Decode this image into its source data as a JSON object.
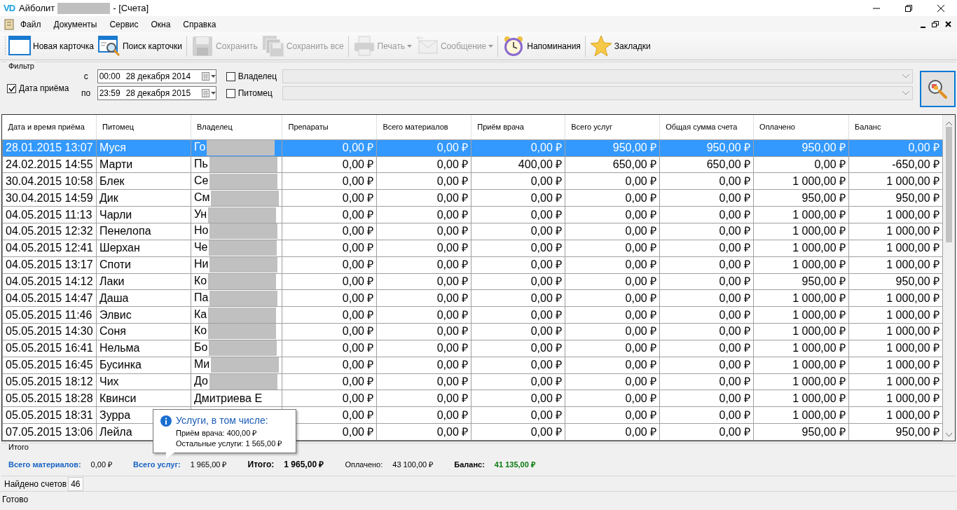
{
  "window": {
    "logo": "VD",
    "title": "Айболит",
    "title_suffix": "- [Счета]",
    "title_redacted": true
  },
  "menu": [
    "Файл",
    "Документы",
    "Сервис",
    "Окна",
    "Справка"
  ],
  "toolbar": [
    {
      "label": "Новая карточка",
      "kind": "new-card",
      "disabled": false,
      "dropdown": false
    },
    {
      "label": "Поиск карточки",
      "kind": "find-card",
      "disabled": false,
      "dropdown": false
    },
    {
      "kind": "separator"
    },
    {
      "label": "Сохранить",
      "kind": "save",
      "disabled": true,
      "dropdown": false
    },
    {
      "label": "Сохранить все",
      "kind": "save-all",
      "disabled": true,
      "dropdown": false
    },
    {
      "kind": "separator"
    },
    {
      "label": "Печать",
      "kind": "print",
      "disabled": true,
      "dropdown": true
    },
    {
      "label": "Сообщение",
      "kind": "message",
      "disabled": true,
      "dropdown": true
    },
    {
      "kind": "separator"
    },
    {
      "label": "Напоминания",
      "kind": "reminder",
      "disabled": false,
      "dropdown": false
    },
    {
      "kind": "separator"
    },
    {
      "label": "Закладки",
      "kind": "bookmark",
      "disabled": false,
      "dropdown": false
    }
  ],
  "filter": {
    "title": "Фильтр",
    "date_check": {
      "label": "Дата приёма",
      "checked": true
    },
    "from": {
      "label": "с",
      "time": "00:00",
      "date": "28 декабря  2014"
    },
    "to": {
      "label": "по",
      "time": "23:59",
      "date": "28 декабря  2015"
    },
    "owner": {
      "label": "Владелец",
      "checked": false
    },
    "pet": {
      "label": "Питомец",
      "checked": false
    }
  },
  "table": {
    "columns": [
      "Дата и время приёма",
      "Питомец",
      "Владелец",
      "Препараты",
      "Всего материалов",
      "Приём врача",
      "Всего услуг",
      "Общая сумма счета",
      "Оплачено",
      "Баланс"
    ],
    "rows": [
      {
        "selected": true,
        "date": "28.01.2015 13:07",
        "pet": "Муся",
        "owner": "Го",
        "redacted": true,
        "amounts": [
          "0,00 ₽",
          "0,00 ₽",
          "0,00 ₽",
          "950,00 ₽",
          "950,00 ₽",
          "950,00 ₽",
          "0,00 ₽"
        ]
      },
      {
        "selected": false,
        "date": "24.02.2015 14:55",
        "pet": "Марти",
        "owner": "Пь",
        "redacted": true,
        "amounts": [
          "0,00 ₽",
          "0,00 ₽",
          "400,00 ₽",
          "650,00 ₽",
          "650,00 ₽",
          "0,00 ₽",
          "-650,00 ₽"
        ]
      },
      {
        "selected": false,
        "date": "30.04.2015 10:58",
        "pet": "Блек",
        "owner": "Се",
        "redacted": true,
        "amounts": [
          "0,00 ₽",
          "0,00 ₽",
          "0,00 ₽",
          "0,00 ₽",
          "0,00 ₽",
          "1 000,00 ₽",
          "1 000,00 ₽"
        ]
      },
      {
        "selected": false,
        "date": "30.04.2015 14:59",
        "pet": "Дик",
        "owner": "См",
        "redacted": true,
        "amounts": [
          "0,00 ₽",
          "0,00 ₽",
          "0,00 ₽",
          "0,00 ₽",
          "0,00 ₽",
          "950,00 ₽",
          "950,00 ₽"
        ]
      },
      {
        "selected": false,
        "date": "04.05.2015 11:13",
        "pet": "Чарли",
        "owner": "Ун",
        "redacted": true,
        "amounts": [
          "0,00 ₽",
          "0,00 ₽",
          "0,00 ₽",
          "0,00 ₽",
          "0,00 ₽",
          "1 000,00 ₽",
          "1 000,00 ₽"
        ]
      },
      {
        "selected": false,
        "date": "04.05.2015 12:32",
        "pet": "Пенелопа",
        "owner": "Но",
        "redacted": true,
        "amounts": [
          "0,00 ₽",
          "0,00 ₽",
          "0,00 ₽",
          "0,00 ₽",
          "0,00 ₽",
          "1 000,00 ₽",
          "1 000,00 ₽"
        ]
      },
      {
        "selected": false,
        "date": "04.05.2015 12:41",
        "pet": "Шерхан",
        "owner": "Че",
        "redacted": true,
        "amounts": [
          "0,00 ₽",
          "0,00 ₽",
          "0,00 ₽",
          "0,00 ₽",
          "0,00 ₽",
          "1 000,00 ₽",
          "1 000,00 ₽"
        ]
      },
      {
        "selected": false,
        "date": "04.05.2015 13:17",
        "pet": "Споти",
        "owner": "Ни",
        "redacted": true,
        "amounts": [
          "0,00 ₽",
          "0,00 ₽",
          "0,00 ₽",
          "0,00 ₽",
          "0,00 ₽",
          "1 000,00 ₽",
          "1 000,00 ₽"
        ]
      },
      {
        "selected": false,
        "date": "04.05.2015 14:12",
        "pet": "Лаки",
        "owner": "Ко",
        "redacted": true,
        "amounts": [
          "0,00 ₽",
          "0,00 ₽",
          "0,00 ₽",
          "0,00 ₽",
          "0,00 ₽",
          "950,00 ₽",
          "950,00 ₽"
        ]
      },
      {
        "selected": false,
        "date": "04.05.2015 14:47",
        "pet": "Даша",
        "owner": "Па",
        "redacted": true,
        "amounts": [
          "0,00 ₽",
          "0,00 ₽",
          "0,00 ₽",
          "0,00 ₽",
          "0,00 ₽",
          "1 000,00 ₽",
          "1 000,00 ₽"
        ]
      },
      {
        "selected": false,
        "date": "05.05.2015 11:46",
        "pet": "Элвис",
        "owner": "Ка",
        "redacted": true,
        "amounts": [
          "0,00 ₽",
          "0,00 ₽",
          "0,00 ₽",
          "0,00 ₽",
          "0,00 ₽",
          "1 000,00 ₽",
          "1 000,00 ₽"
        ]
      },
      {
        "selected": false,
        "date": "05.05.2015 14:30",
        "pet": "Соня",
        "owner": "Ко",
        "redacted": true,
        "amounts": [
          "0,00 ₽",
          "0,00 ₽",
          "0,00 ₽",
          "0,00 ₽",
          "0,00 ₽",
          "1 000,00 ₽",
          "1 000,00 ₽"
        ]
      },
      {
        "selected": false,
        "date": "05.05.2015 16:41",
        "pet": "Нельма",
        "owner": "Бо",
        "redacted": true,
        "amounts": [
          "0,00 ₽",
          "0,00 ₽",
          "0,00 ₽",
          "0,00 ₽",
          "0,00 ₽",
          "1 000,00 ₽",
          "1 000,00 ₽"
        ]
      },
      {
        "selected": false,
        "date": "05.05.2015 16:45",
        "pet": "Бусинка",
        "owner": "Ми",
        "redacted": true,
        "amounts": [
          "0,00 ₽",
          "0,00 ₽",
          "0,00 ₽",
          "0,00 ₽",
          "0,00 ₽",
          "1 000,00 ₽",
          "1 000,00 ₽"
        ]
      },
      {
        "selected": false,
        "date": "05.05.2015 18:12",
        "pet": "Чих",
        "owner": "До",
        "redacted": true,
        "amounts": [
          "0,00 ₽",
          "0,00 ₽",
          "0,00 ₽",
          "0,00 ₽",
          "0,00 ₽",
          "1 000,00 ₽",
          "1 000,00 ₽"
        ]
      },
      {
        "selected": false,
        "date": "05.05.2015 18:28",
        "pet": "Квинси",
        "owner": "Дмитриева Е",
        "redacted": false,
        "amounts": [
          "0,00 ₽",
          "0,00 ₽",
          "0,00 ₽",
          "0,00 ₽",
          "0,00 ₽",
          "1 000,00 ₽",
          "1 000,00 ₽"
        ]
      },
      {
        "selected": false,
        "date": "05.05.2015 18:31",
        "pet": "Зурра",
        "redacted": false,
        "amounts": [
          "0,00 ₽",
          "0,00 ₽",
          "0,00 ₽",
          "0,00 ₽",
          "0,00 ₽",
          "1 000,00 ₽",
          "1 000,00 ₽"
        ]
      },
      {
        "selected": false,
        "date": "07.05.2015 13:06",
        "pet": "Лейла",
        "redacted": false,
        "amounts": [
          "0,00 ₽",
          "0,00 ₽",
          "0,00 ₽",
          "0,00 ₽",
          "0,00 ₽",
          "950,00 ₽",
          "950,00 ₽"
        ]
      }
    ]
  },
  "tooltip": {
    "title": "Услуги, в том числе:",
    "lines": [
      "Приём врача: 400,00 ₽",
      "Остальные услуги: 1 565,00 ₽"
    ]
  },
  "totals": {
    "title": "Итого",
    "items": [
      {
        "kind": "link",
        "label": "Всего материалов:",
        "value": "0,00 ₽"
      },
      {
        "kind": "link",
        "label": "Всего услуг:",
        "value": "1 965,00 ₽"
      },
      {
        "kind": "bold",
        "label": "Итого:",
        "value": "1 965,00 ₽"
      },
      {
        "kind": "plain",
        "label": "Оплачено:",
        "value": "43 100,00 ₽"
      },
      {
        "kind": "balance",
        "label": "Баланс:",
        "value": "41 135,00 ₽"
      }
    ]
  },
  "found": {
    "label": "Найдено счетов",
    "count": "46"
  },
  "status_bar": "Готово"
}
